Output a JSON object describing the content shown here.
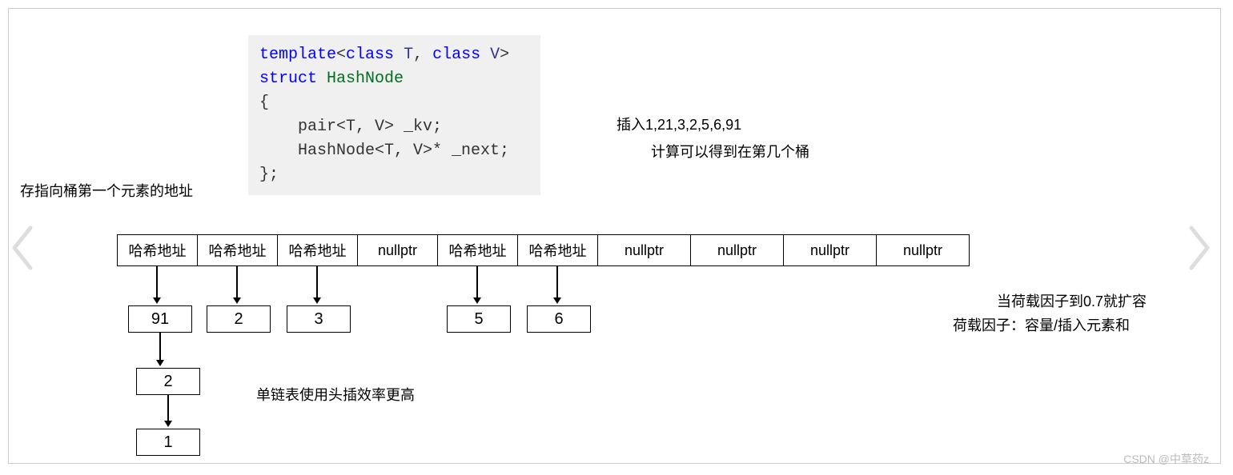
{
  "code": {
    "line1_kw1": "template",
    "line1_kw2": "class",
    "line1_t": "T",
    "line1_kw3": "class",
    "line1_v": "V",
    "line2_kw": "struct",
    "line2_name": "HashNode",
    "line4": "    pair<T, V> _kv;",
    "line5": "    HashNode<T, V>* _next;"
  },
  "labels": {
    "pointer_note": "存指向桶第一个元素的地址",
    "insert_note": "插入1,21,3,2,5,6,91",
    "bucket_calc": "计算可以得到在第几个桶",
    "list_note": "单链表使用头插效率更高",
    "load_note1": "当荷载因子到0.7就扩容",
    "load_note2": "荷载因子：容量/插入元素和"
  },
  "buckets": [
    "哈希地址",
    "哈希地址",
    "哈希地址",
    "nullptr",
    "哈希地址",
    "哈希地址",
    "nullptr",
    "nullptr",
    "nullptr",
    "nullptr"
  ],
  "chains": {
    "c0": [
      "91",
      "2",
      "1"
    ],
    "c1": [
      "2"
    ],
    "c2": [
      "3"
    ],
    "c4": [
      "5"
    ],
    "c5": [
      "6"
    ]
  },
  "watermark": "CSDN @中草药z"
}
